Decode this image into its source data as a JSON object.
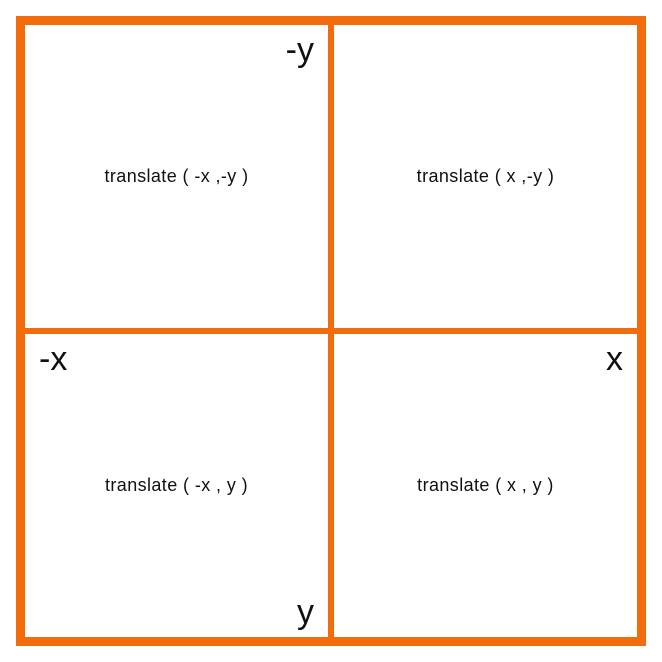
{
  "diagram": {
    "quadrants": {
      "top_left": {
        "label": "translate ( -x ,-y )",
        "axis": "-y"
      },
      "top_right": {
        "label": "translate ( x ,-y )"
      },
      "bottom_left": {
        "label": "translate ( -x , y )",
        "axis_left": "-x",
        "axis_bottom": "y"
      },
      "bottom_right": {
        "label": "translate ( x , y )",
        "axis": "x"
      }
    }
  }
}
